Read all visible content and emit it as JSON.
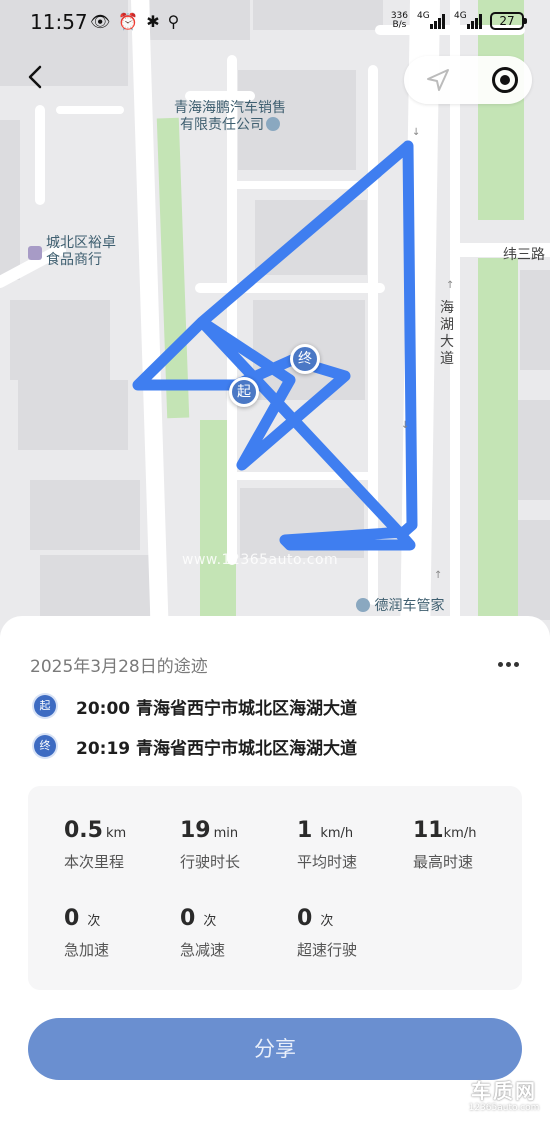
{
  "status_bar": {
    "time": "11:57",
    "net_speed_value": "336",
    "net_speed_unit": "B/s",
    "signal1_label": "4G",
    "signal2_label": "4G",
    "battery": "27"
  },
  "map": {
    "labels": {
      "poi_company": "青海海鹏汽车销售\n有限责任公司",
      "poi_shop": "城北区裕卓\n食品商行",
      "road_weisan": "纬三路",
      "road_haihu": "海湖大道",
      "poi_derun": "德润车管家",
      "watermark": "www.12365auto.com"
    },
    "start_marker": "起",
    "end_marker": "终",
    "colors": {
      "route": "#3f7ef0",
      "park": "#c7e6b7",
      "road": "#ffffff",
      "block": "#d9d9dc",
      "marker": "#4a78c5"
    }
  },
  "trip": {
    "title": "2025年3月28日的途迹",
    "start": {
      "badge": "起",
      "time_place": "20:00 青海省西宁市城北区海湖大道"
    },
    "end": {
      "badge": "终",
      "time_place": "20:19 青海省西宁市城北区海湖大道"
    }
  },
  "stats": [
    {
      "value": "0.5",
      "unit": "km",
      "label": "本次里程"
    },
    {
      "value": "19",
      "unit": "min",
      "label": "行驶时长"
    },
    {
      "value": "1",
      "unit": "km/h",
      "label": "平均时速"
    },
    {
      "value": "11",
      "unit": "km/h",
      "label": "最高时速"
    },
    {
      "value": "0",
      "unit": "次",
      "label": "急加速"
    },
    {
      "value": "0",
      "unit": "次",
      "label": "急减速"
    },
    {
      "value": "0",
      "unit": "次",
      "label": "超速行驶"
    }
  ],
  "share_button": "分享",
  "brand_watermark": {
    "big": "车质网",
    "small": "12365auto.com"
  }
}
